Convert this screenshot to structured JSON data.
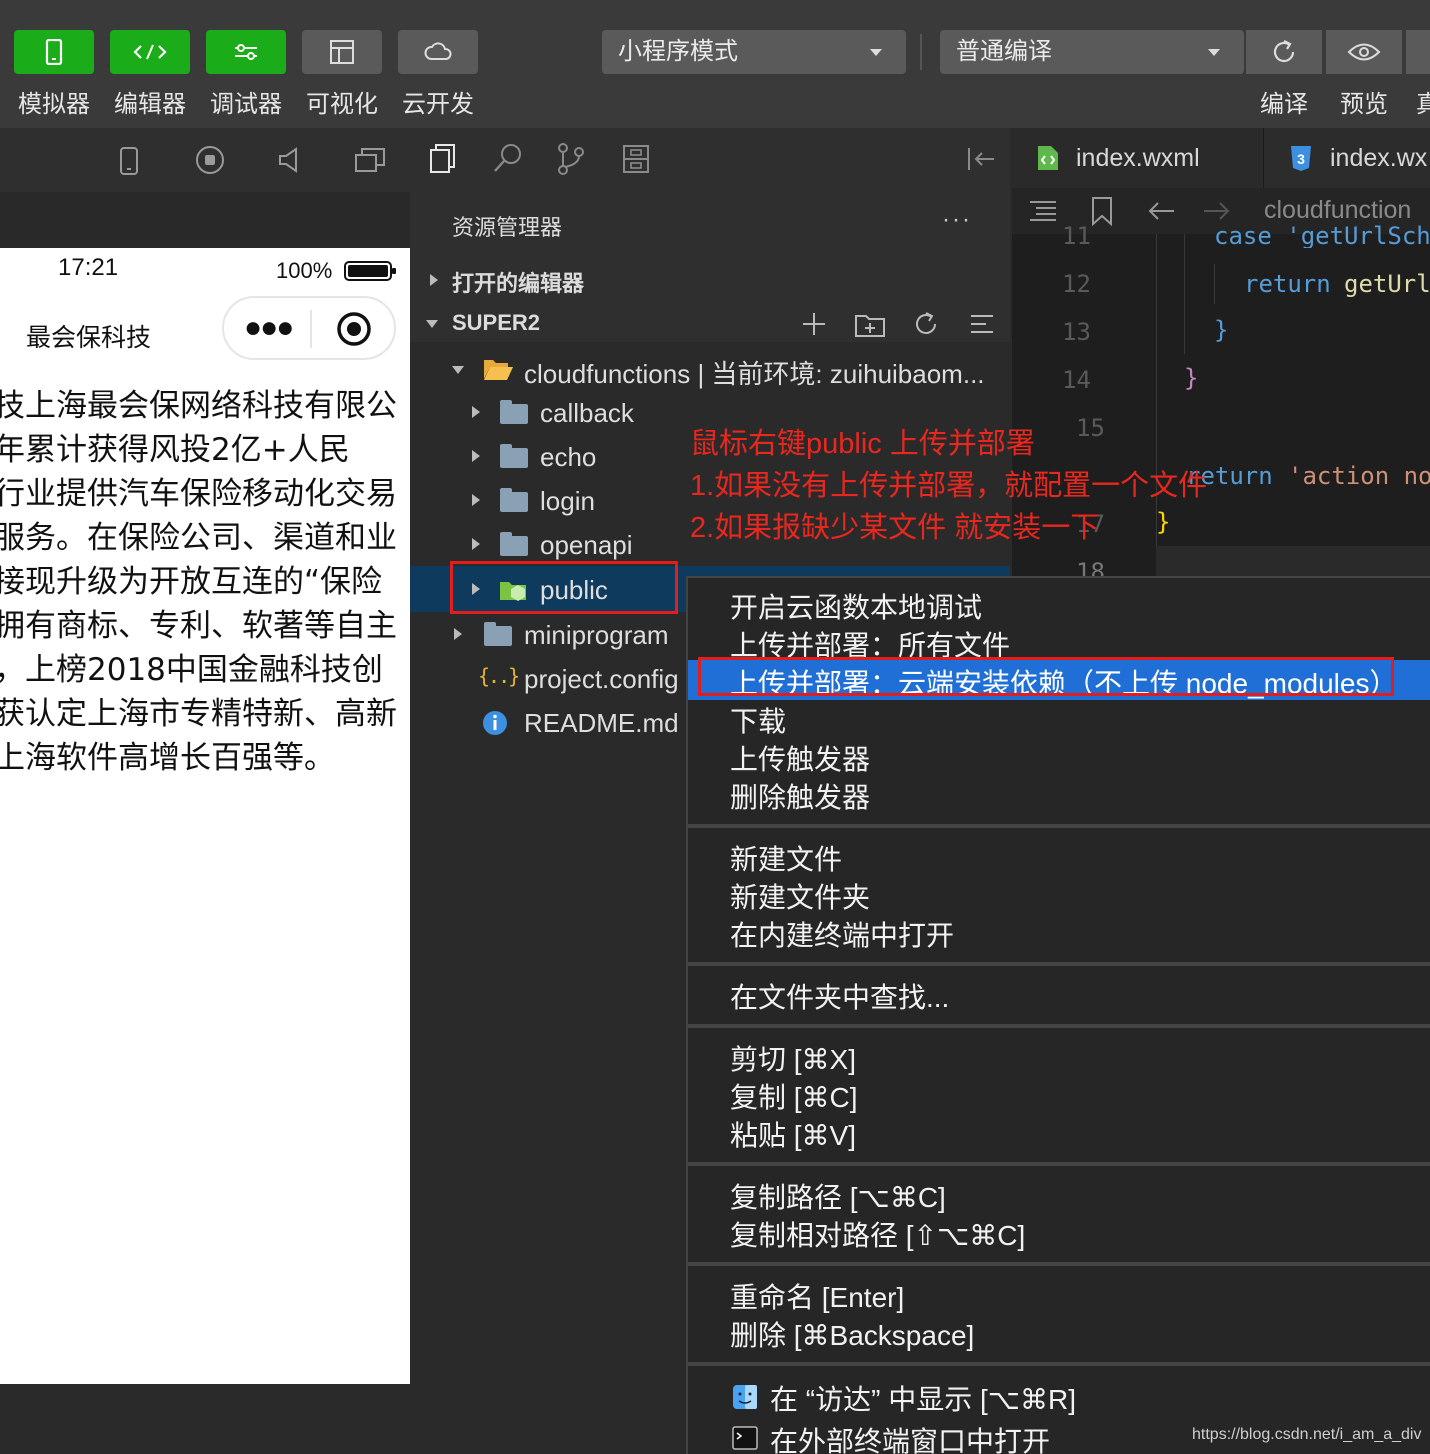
{
  "toolbar": {
    "buttons": [
      {
        "label": "模拟器",
        "icon": "phone-icon"
      },
      {
        "label": "编辑器",
        "icon": "code-icon"
      },
      {
        "label": "调试器",
        "icon": "debug-sliders-icon"
      },
      {
        "label": "可视化",
        "icon": "layout-icon"
      },
      {
        "label": "云开发",
        "icon": "cloud-icon"
      }
    ],
    "mode_select": "小程序模式",
    "compile_select": "普通编译",
    "compile_label": "编译",
    "preview_label": "预览",
    "cutoff_label": "真"
  },
  "phone": {
    "time": "17:21",
    "battery": "100%",
    "title": "最会保科技",
    "lines": [
      "技上海最会保网络科技有限公",
      "年累计获得风投2亿+人民",
      "行业提供汽车保险移动化交易",
      "服务。在保险公司、渠道和业",
      "接现升级为开放互连的“保险",
      "拥有商标、专利、软著等自主",
      "，上榜2018中国金融科技创",
      "获认定上海市专精特新、高新",
      "上海软件高增长百强等。"
    ]
  },
  "explorer": {
    "title": "资源管理器",
    "more": "···",
    "open_editors": "打开的编辑器",
    "workspace": "SUPER2",
    "tree": {
      "cloudfunctions": "cloudfunctions | 当前环境: zuihuibaom...",
      "callback": "callback",
      "echo": "echo",
      "login": "login",
      "openapi": "openapi",
      "public": "public",
      "miniprogram": "miniprogram",
      "project_config": "project.config",
      "readme": "README.md"
    },
    "json_glyph": "{..}"
  },
  "editor": {
    "tabs": [
      "index.wxml",
      "index.wx"
    ],
    "breadcrumb": "cloudfunction",
    "line_numbers": [
      "11",
      "12",
      "13",
      "14",
      "15",
      "17",
      "18"
    ],
    "code": {
      "l11": "case 'getUrlSch",
      "l12_kw": "return",
      "l12_fn": "getUrl",
      "close1": "}",
      "close2": "}",
      "l16_kw": "return",
      "l16_str": "'action no",
      "close3": "}"
    }
  },
  "annotation": {
    "line1": "鼠标右键public   上传并部署",
    "line2": "1.如果没有上传并部署，就配置一个文件",
    "line3": "2.如果报缺少某文件 就安装一下"
  },
  "menu": {
    "items": [
      "开启云函数本地调试",
      "上传并部署：所有文件",
      "上传并部署：云端安装依赖（不上传 node_modules）",
      "下载",
      "上传触发器",
      "删除触发器",
      "新建文件",
      "新建文件夹",
      "在内建终端中打开",
      "在文件夹中查找...",
      "剪切 [⌘X]",
      "复制 [⌘C]",
      "粘贴 [⌘V]",
      "复制路径 [⌥⌘C]",
      "复制相对路径 [⇧⌥⌘C]",
      "重命名 [Enter]",
      "删除 [⌘Backspace]",
      "在 “访达” 中显示 [⌥⌘R]",
      "在外部终端窗口中打开"
    ]
  },
  "watermark": "https://blog.csdn.net/i_am_a_div",
  "colors": {
    "accent_green": "#1aad19",
    "highlight_blue": "#1f6fd6",
    "annotation_red": "#e8271f"
  }
}
